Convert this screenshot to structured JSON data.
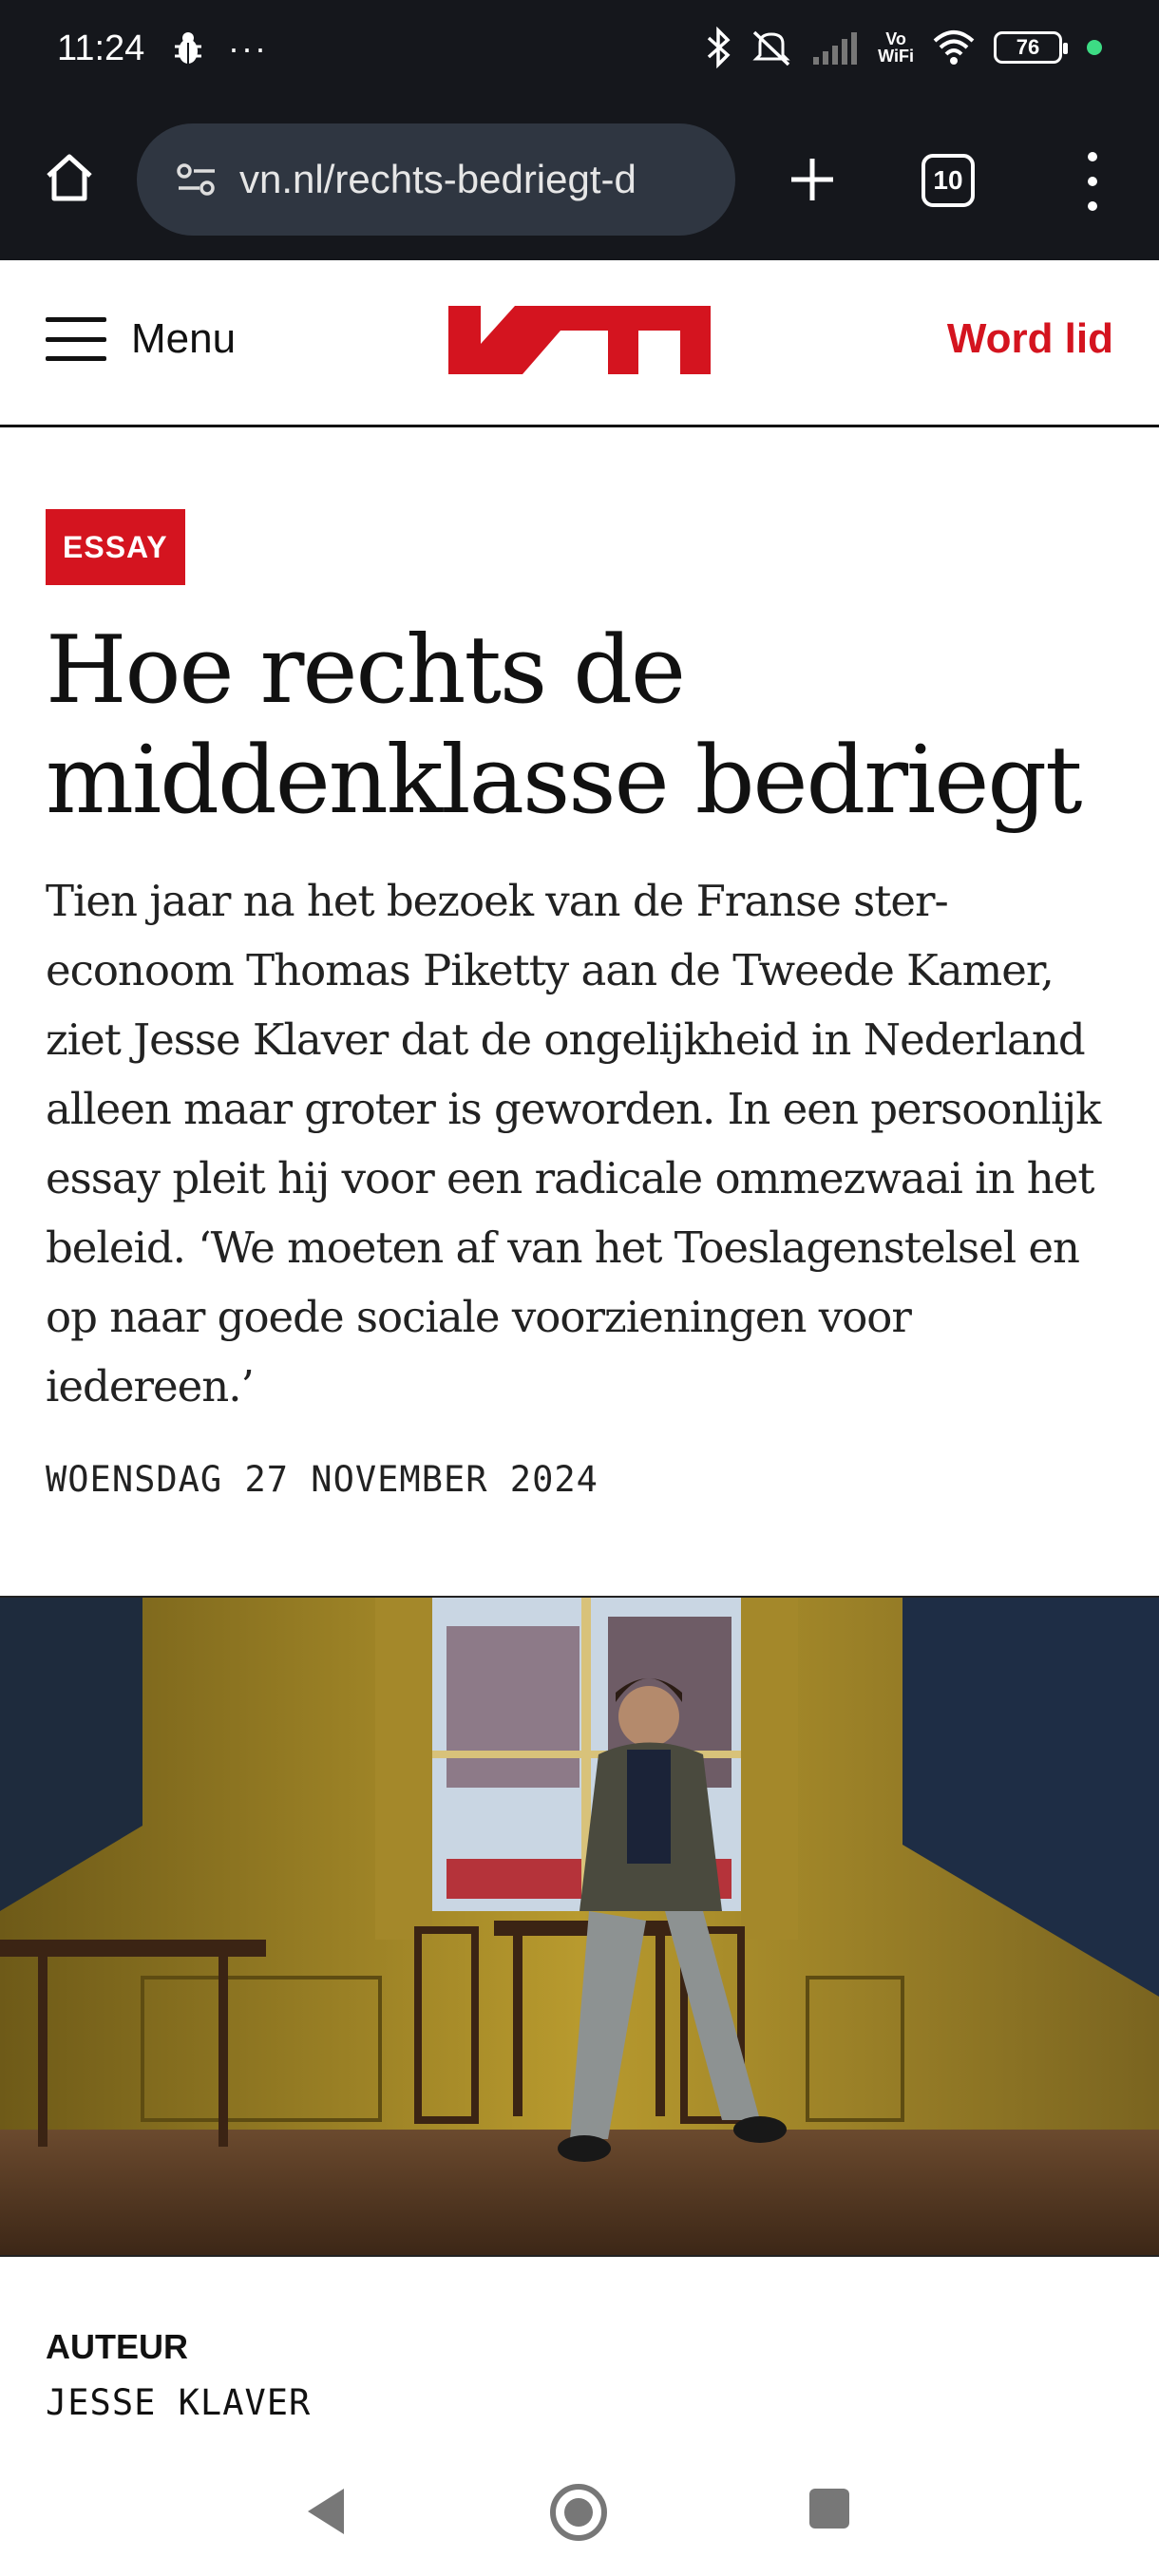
{
  "statusbar": {
    "time": "11:24",
    "more": "···",
    "network_label": "Vo\nWiFi",
    "battery": "76"
  },
  "browser": {
    "url": "vn.nl/rechts-bedriegt-d",
    "tab_count": "10"
  },
  "site": {
    "menu_label": "Menu",
    "logo_name": "vn-logo",
    "cta_label": "Word lid",
    "brand_color": "#d4141f"
  },
  "article": {
    "category": "ESSAY",
    "title": "Hoe rechts de middenklasse bedriegt",
    "lead": "Tien jaar na het bezoek van de Franse ster-econoom Thomas Piketty aan de Tweede Kamer, ziet Jesse Klaver dat de ongelijkheid in Nederland alleen maar groter is geworden. In een persoonlijk essay pleit hij voor een radicale ommezwaai in het beleid. ‘We moeten af van het Toeslagenstelsel en op naar goede sociale voorzieningen voor iedereen.’",
    "date": "WOENSDAG 27 NOVEMBER 2024",
    "author_label": "AUTEUR",
    "author_name": "JESSE KLAVER"
  }
}
